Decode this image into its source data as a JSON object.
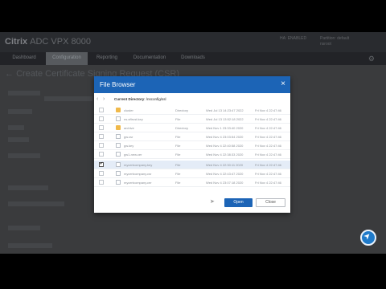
{
  "app": {
    "brand": "Citrix",
    "product": "ADC VPX 8000",
    "topinfo_lines": [
      "HA: ENABLED",
      "Partition: default",
      "nsroot"
    ],
    "tabs": [
      {
        "label": "Dashboard",
        "active": false
      },
      {
        "label": "Configuration",
        "active": true
      },
      {
        "label": "Reporting",
        "active": false
      },
      {
        "label": "Documentation",
        "active": false
      },
      {
        "label": "Downloads",
        "active": false
      }
    ],
    "page_title": "Create Certificate Signing Request (CSR)"
  },
  "dialog": {
    "title": "File Browser",
    "close_glyph": "×",
    "directory_label": "Current Directory",
    "directory_path": "/nsconfig/ssl",
    "back_glyph": "‹",
    "forward_glyph": "›",
    "files": [
      {
        "name": "cluster",
        "type": "Directory",
        "modified": "Wed Jul 13 14:23:47 2022",
        "size": "Fri Nov 4 22:47:46",
        "is_folder": true,
        "selected": false
      },
      {
        "name": "ns-sftrust.key",
        "type": "File",
        "modified": "Wed Jul 13 13:52:18 2022",
        "size": "Fri Nov 4 22:47:46",
        "is_folder": false,
        "selected": false
      },
      {
        "name": "archive",
        "type": "Directory",
        "modified": "Wed Nov 1 23:33:40 2020",
        "size": "Fri Nov 4 22:47:46",
        "is_folder": true,
        "selected": false
      },
      {
        "name": "gw.csr",
        "type": "File",
        "modified": "Wed Nov 4 23:03:54 2020",
        "size": "Fri Nov 4 22:47:46",
        "is_folder": false,
        "selected": false
      },
      {
        "name": "gw.key",
        "type": "File",
        "modified": "Wed Nov 4 22:40:58 2020",
        "size": "Fri Nov 4 22:47:46",
        "is_folder": false,
        "selected": false
      },
      {
        "name": "gw1-new.cer",
        "type": "File",
        "modified": "Wed Nov 4 22:38:33 2020",
        "size": "Fri Nov 4 22:47:46",
        "is_folder": false,
        "selected": false
      },
      {
        "name": "mycertcompany.key",
        "type": "File",
        "modified": "Wed Nov 4 22:30:11 2020",
        "size": "Fri Nov 4 22:47:46",
        "is_folder": false,
        "selected": true
      },
      {
        "name": "mycertcompany.csr",
        "type": "File",
        "modified": "Wed Nov 4 22:43:47 2020",
        "size": "Fri Nov 4 22:47:46",
        "is_folder": false,
        "selected": false
      },
      {
        "name": "mycertcompany.cer",
        "type": "File",
        "modified": "Wed Nov 4 23:07:18 2020",
        "size": "Fri Nov 4 22:47:46",
        "is_folder": false,
        "selected": false
      }
    ],
    "open_label": "Open",
    "close_label": "Close"
  },
  "colors": {
    "dialog_header": "#1c64b6",
    "selected_row": "#e4ecf7",
    "folder": "#f0b94a"
  }
}
